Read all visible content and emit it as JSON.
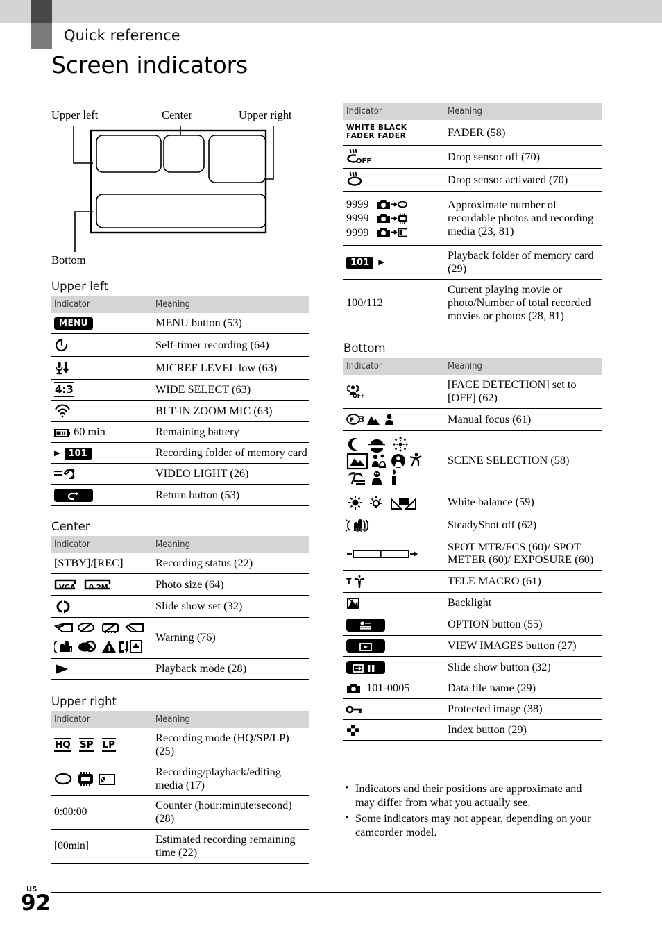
{
  "header": {
    "section_label": "Quick reference",
    "title": "Screen indicators"
  },
  "diagram": {
    "label_upper_left": "Upper left",
    "label_center": "Center",
    "label_upper_right": "Upper right",
    "label_bottom": "Bottom"
  },
  "table_headers": {
    "indicator": "Indicator",
    "meaning": "Meaning"
  },
  "sections": {
    "upper_left": {
      "heading": "Upper left",
      "rows": [
        {
          "icon": "menu-button-icon",
          "indicator": "MENU",
          "meaning": "MENU button (53)"
        },
        {
          "icon": "self-timer-icon",
          "indicator": "",
          "meaning": "Self-timer recording (64)"
        },
        {
          "icon": "micref-level-low-icon",
          "indicator": "",
          "meaning": "MICREF LEVEL low (63)"
        },
        {
          "icon": "wide-select-icon",
          "indicator": "4:3",
          "meaning": "WIDE SELECT (63)"
        },
        {
          "icon": "zoom-mic-icon",
          "indicator": "",
          "meaning": "BLT-IN ZOOM MIC (63)"
        },
        {
          "icon": "battery-icon",
          "indicator": "60 min",
          "meaning": "Remaining battery"
        },
        {
          "icon": "recording-folder-icon",
          "indicator": "101",
          "meaning": "Recording folder of memory card"
        },
        {
          "icon": "video-light-icon",
          "indicator": "",
          "meaning": "VIDEO LIGHT (26)"
        },
        {
          "icon": "return-button-icon",
          "indicator": "",
          "meaning": "Return button (53)"
        }
      ]
    },
    "center": {
      "heading": "Center",
      "rows": [
        {
          "icon": "recording-status-text",
          "indicator": "[STBY]/[REC]",
          "meaning": "Recording status (22)"
        },
        {
          "icon": "photo-size-icon",
          "indicator": "VGA  0.2M",
          "meaning": "Photo size (64)"
        },
        {
          "icon": "slide-show-set-icon",
          "indicator": "",
          "meaning": "Slide show set (32)"
        },
        {
          "icon": "warning-icons",
          "indicator": "",
          "meaning": "Warning (76)"
        },
        {
          "icon": "playback-mode-icon",
          "indicator": "",
          "meaning": "Playback mode (28)"
        }
      ]
    },
    "upper_right": {
      "heading": "Upper right",
      "rows": [
        {
          "icon": "recording-mode-icon",
          "indicator": "HQ SP LP",
          "meaning": "Recording mode (HQ/SP/LP) (25)"
        },
        {
          "icon": "media-icons",
          "indicator": "",
          "meaning": "Recording/playback/editing media (17)"
        },
        {
          "icon": "counter-text",
          "indicator": "0:00:00",
          "meaning": "Counter (hour:minute:second) (28)"
        },
        {
          "icon": "remaining-time-text",
          "indicator": "[00min]",
          "meaning": "Estimated recording remaining time (22)"
        }
      ]
    },
    "right_top": {
      "heading": "",
      "rows": [
        {
          "icon": "fader-icon",
          "indicator": "WHITE BLACK FADER FADER",
          "meaning": "FADER (58)"
        },
        {
          "icon": "drop-sensor-off-icon",
          "indicator": "OFF",
          "meaning": "Drop sensor off (70)"
        },
        {
          "icon": "drop-sensor-activated-icon",
          "indicator": "",
          "meaning": "Drop sensor activated (70)"
        },
        {
          "icon": "recordable-photos-icon",
          "indicator": "9999 9999 9999",
          "meaning": "Approximate number of recordable photos and recording media (23, 81)"
        },
        {
          "icon": "playback-folder-icon",
          "indicator": "101",
          "meaning": "Playback folder of memory card (29)"
        },
        {
          "icon": "current-playing-text",
          "indicator": "100/112",
          "meaning": "Current playing movie or photo/Number of total recorded movies or photos (28, 81)"
        }
      ]
    },
    "bottom": {
      "heading": "Bottom",
      "rows": [
        {
          "icon": "face-detection-off-icon",
          "indicator": "OFF",
          "meaning": "[FACE DETECTION] set to [OFF] (62)"
        },
        {
          "icon": "manual-focus-icons",
          "indicator": "",
          "meaning": "Manual focus (61)"
        },
        {
          "icon": "scene-selection-icons",
          "indicator": "",
          "meaning": "SCENE SELECTION (58)"
        },
        {
          "icon": "white-balance-icons",
          "indicator": "",
          "meaning": "White balance (59)"
        },
        {
          "icon": "steadyshot-off-icon",
          "indicator": "OFF",
          "meaning": "SteadyShot off (62)"
        },
        {
          "icon": "spot-meter-slider-icon",
          "indicator": "",
          "meaning": "SPOT MTR/FCS (60)/ SPOT METER (60)/ EXPOSURE (60)"
        },
        {
          "icon": "tele-macro-icon",
          "indicator": "T",
          "meaning": "TELE MACRO (61)"
        },
        {
          "icon": "backlight-icon",
          "indicator": "",
          "meaning": "Backlight"
        },
        {
          "icon": "option-button-icon",
          "indicator": "",
          "meaning": "OPTION button (55)"
        },
        {
          "icon": "view-images-button-icon",
          "indicator": "",
          "meaning": "VIEW IMAGES button (27)"
        },
        {
          "icon": "slide-show-button-icon",
          "indicator": "",
          "meaning": "Slide show button (32)"
        },
        {
          "icon": "data-file-name-icon",
          "indicator": "101-0005",
          "meaning": "Data file name (29)"
        },
        {
          "icon": "protected-image-icon",
          "indicator": "",
          "meaning": "Protected image (38)"
        },
        {
          "icon": "index-button-icon",
          "indicator": "",
          "meaning": "Index button (29)"
        }
      ]
    }
  },
  "notes": [
    "Indicators and their positions are approximate and may differ from what you actually see.",
    "Some indicators may not appear, depending on your camcorder model."
  ],
  "footer": {
    "locale": "US",
    "page_number": "92"
  }
}
